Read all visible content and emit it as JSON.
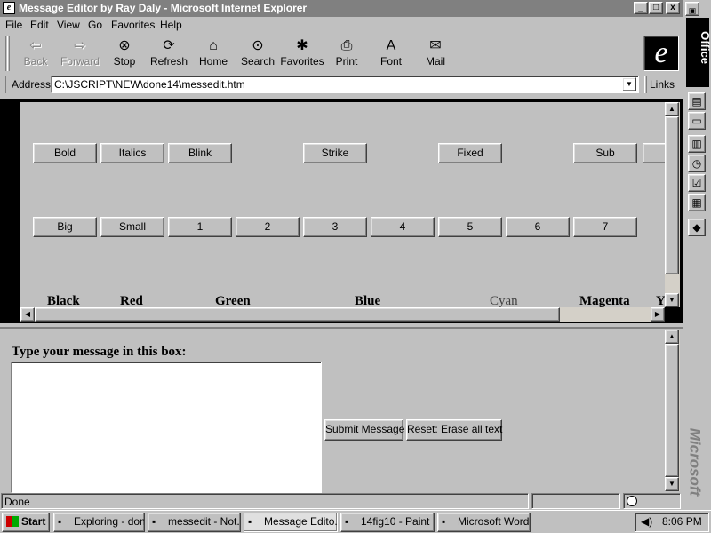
{
  "window": {
    "title": "Message Editor by Ray Daly - Microsoft Internet Explorer",
    "app_icon": "e",
    "minimize_glyph": "_",
    "maximize_glyph": "□",
    "close_glyph": "x"
  },
  "menu": [
    "File",
    "Edit",
    "View",
    "Go",
    "Favorites",
    "Help"
  ],
  "toolbar": [
    {
      "label": "Back",
      "icon": "back-arrow-icon",
      "glyph": "⇦",
      "enabled": false
    },
    {
      "label": "Forward",
      "icon": "forward-arrow-icon",
      "glyph": "⇨",
      "enabled": false
    },
    {
      "label": "Stop",
      "icon": "stop-icon",
      "glyph": "⊗",
      "enabled": true
    },
    {
      "label": "Refresh",
      "icon": "refresh-icon",
      "glyph": "⟳",
      "enabled": true
    },
    {
      "label": "Home",
      "icon": "home-icon",
      "glyph": "⌂",
      "enabled": true
    },
    {
      "label": "Search",
      "icon": "search-icon",
      "glyph": "⊙",
      "enabled": true
    },
    {
      "label": "Favorites",
      "icon": "favorites-icon",
      "glyph": "✱",
      "enabled": true
    },
    {
      "label": "Print",
      "icon": "print-icon",
      "glyph": "⎙",
      "enabled": true
    },
    {
      "label": "Font",
      "icon": "font-icon",
      "glyph": "A",
      "enabled": true
    },
    {
      "label": "Mail",
      "icon": "mail-icon",
      "glyph": "✉",
      "enabled": true
    }
  ],
  "ie_logo": "e",
  "address": {
    "label": "Address",
    "value": "C:\\JSCRIPT\\NEW\\done14\\messedit.htm",
    "links_label": "Links",
    "dropdown_glyph": "▼"
  },
  "format_buttons_row1": [
    "Bold",
    "Italics",
    "Blink",
    "Strike",
    "Fixed",
    "Sub"
  ],
  "format_buttons_row2": [
    "Big",
    "Small",
    "1",
    "2",
    "3",
    "4",
    "5",
    "6",
    "7"
  ],
  "color_labels": [
    "Black",
    "Red",
    "Green",
    "Blue",
    "Cyan",
    "Magenta",
    "Y"
  ],
  "colors": {
    "Black": "#000000",
    "Red": "#000000",
    "Green": "#000000",
    "Blue": "#000000",
    "Cyan": "#404040",
    "Magenta": "#000000"
  },
  "scroll_glyphs": {
    "up": "▲",
    "down": "▼",
    "left": "◀",
    "right": "▶"
  },
  "form": {
    "prompt": "Type your message in this box:",
    "message_value": "",
    "submit_label": "Submit Message",
    "reset_label": "Reset:  Erase all text"
  },
  "status": {
    "text": "Done"
  },
  "office_bar": {
    "label": "Office",
    "brand": "Microsoft",
    "icons": [
      "office-logo-icon",
      "new-document-icon",
      "open-document-icon",
      "contact-card-icon",
      "appointment-icon",
      "task-icon",
      "address-book-icon",
      "office-answer-icon"
    ]
  },
  "taskbar": {
    "start_label": "Start",
    "tasks": [
      {
        "label": "Exploring - don...",
        "icon": "explorer-icon",
        "active": false
      },
      {
        "label": "messedit - Not...",
        "icon": "notepad-icon",
        "active": false
      },
      {
        "label": "Message Edito...",
        "icon": "ie-icon",
        "active": true
      },
      {
        "label": "14fig10 - Paint",
        "icon": "paint-icon",
        "active": false
      },
      {
        "label": "Microsoft Word...",
        "icon": "word-icon",
        "active": false
      }
    ],
    "time": "8:06 PM"
  }
}
